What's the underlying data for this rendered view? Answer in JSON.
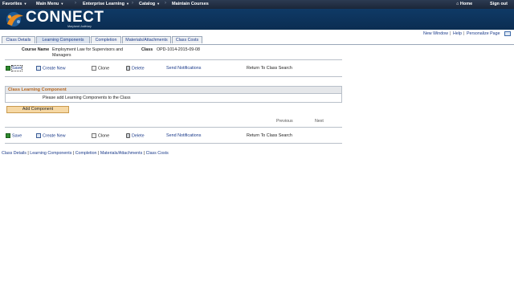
{
  "topnav": {
    "favorites": "Favorites",
    "main_menu": "Main Menu",
    "crumb1": "Enterprise Learning",
    "crumb2": "Catalog",
    "crumb3": "Maintain Courses",
    "home": "Home",
    "sign_out": "Sign out"
  },
  "brand": {
    "name": "CONNECT",
    "tagline": "Maryland Judiciary"
  },
  "util_links": {
    "new_window": "New Window",
    "help": "Help",
    "personalize": "Personalize Page",
    "sep": "|"
  },
  "tabs": [
    "Class Details",
    "Learning Components",
    "Completion",
    "Materials/Attachments",
    "Class Costs"
  ],
  "course": {
    "course_name_label": "Course Name",
    "course_name_value": "Employment Law for Supervisors and Managers",
    "class_label": "Class",
    "class_value": "OPD-1014-2015-09-08"
  },
  "toolbar": {
    "save": "Save",
    "create_new": "Create New",
    "clone": "Clone",
    "delete": "Delete",
    "send_notifications": "Send Notifications",
    "return": "Return To Class Search"
  },
  "section": {
    "title": "Class Learning Component",
    "message": "Please add Learning Components to the Class"
  },
  "add_component": "Add Component",
  "pager": {
    "previous": "Previous",
    "next": "Next"
  },
  "footer_links": {
    "class_details": "Class Details",
    "learning_components": "Learning Components",
    "completion": "Completion",
    "materials": "Materials/Attachments",
    "class_costs": "Class Costs",
    "sep": " | "
  },
  "colors": {
    "nav_bg": "#1b2638",
    "banner_bg": "#0f3a66",
    "link": "#1a3a8a",
    "section_title": "#b5651d",
    "button_bg": "#f6d8a4"
  }
}
